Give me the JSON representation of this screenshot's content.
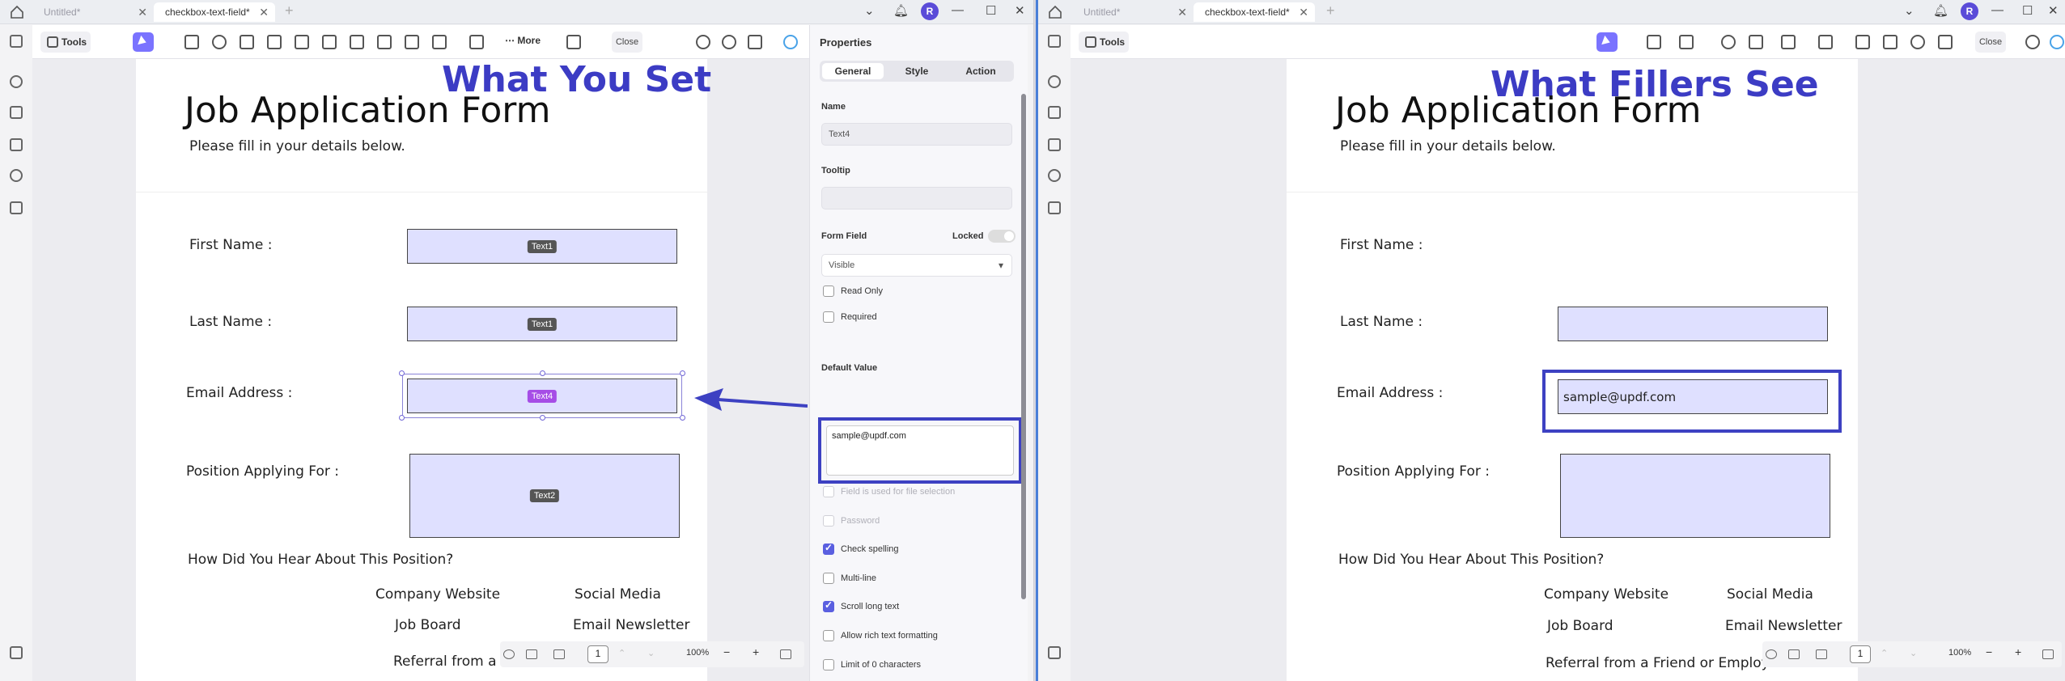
{
  "left_window": {
    "tabs": [
      {
        "label": "Untitled*",
        "active": false
      },
      {
        "label": "checkbox-text-field*",
        "active": true
      }
    ],
    "avatar": "R",
    "toolbar": {
      "tools": "Tools",
      "more": "More",
      "close": "Close"
    },
    "overlay_title": "What You Set",
    "document": {
      "title": "Job Application Form",
      "subtitle": "Please fill in your details below.",
      "labels": {
        "first_name": "First Name :",
        "last_name": "Last Name :",
        "email": "Email Address :",
        "position": "Position Applying For :",
        "hear": "How Did You Hear About This Position?",
        "opt_company": "Company Website",
        "opt_social": "Social Media",
        "opt_job": "Job Board",
        "opt_newsletter": "Email Newsletter",
        "opt_referral": "Referral from a Fri"
      },
      "field_tags": {
        "first": "Text1",
        "last": "Text1",
        "email": "Text4",
        "position": "Text2"
      }
    },
    "bottombar": {
      "page": "1",
      "zoom": "100%"
    },
    "properties": {
      "heading": "Properties",
      "tabs": [
        "General",
        "Style",
        "Action"
      ],
      "name_label": "Name",
      "name_value": "Text4",
      "tooltip_label": "Tooltip",
      "tooltip_value": "",
      "form_field_label": "Form Field",
      "locked_label": "Locked",
      "visibility": "Visible",
      "read_only": "Read Only",
      "required": "Required",
      "default_value_label": "Default Value",
      "default_value": "sample@updf.com",
      "file_selection": "Field is used for file selection",
      "password": "Password",
      "check_spelling": "Check spelling",
      "multi_line": "Multi-line",
      "scroll_long": "Scroll long text",
      "rich_text": "Allow rich text formatting",
      "limit": "Limit of 0 characters",
      "limit_value": "0"
    }
  },
  "right_window": {
    "tabs": [
      {
        "label": "Untitled*",
        "active": false
      },
      {
        "label": "checkbox-text-field*",
        "active": true
      }
    ],
    "avatar": "R",
    "toolbar": {
      "tools": "Tools",
      "close": "Close"
    },
    "overlay_title": "What Fillers See",
    "document": {
      "title": "Job Application Form",
      "subtitle": "Please fill in your details below.",
      "labels": {
        "first_name": "First Name :",
        "last_name": "Last Name :",
        "email": "Email Address :",
        "position": "Position Applying For :",
        "hear": "How Did You Hear About This Position?",
        "opt_company": "Company Website",
        "opt_social": "Social Media",
        "opt_job": "Job Board",
        "opt_newsletter": "Email Newsletter",
        "opt_referral": "Referral from a Friend or Employee"
      },
      "email_value": "sample@updf.com"
    },
    "bottombar": {
      "page": "1",
      "zoom": "100%"
    }
  },
  "colors": {
    "accent": "#7a73ff",
    "highlight": "#3d41c2",
    "field_fill": "#dfe0ff",
    "overlay_text": "#3c3cc4"
  }
}
